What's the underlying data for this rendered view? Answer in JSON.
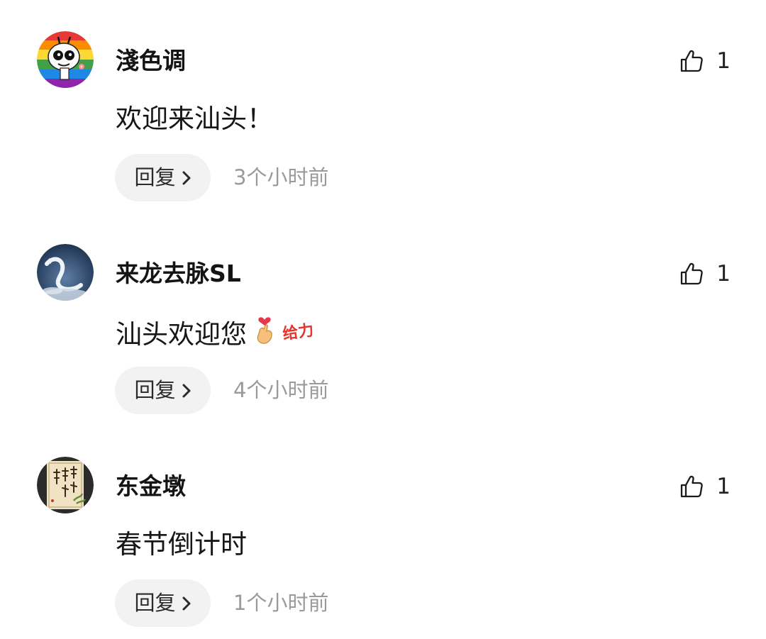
{
  "comments": [
    {
      "username": "淺色调",
      "text": "欢迎来汕头！",
      "likes": "1",
      "reply_label": "回复",
      "time": "3个小时前",
      "avatar": "cartoon-face-avatar"
    },
    {
      "username": "来龙去脉SL",
      "text": "汕头欢迎您",
      "emojis": [
        "finger-heart-emoji",
        "gei-li-sticker"
      ],
      "sticker_text": "给力",
      "likes": "1",
      "reply_label": "回复",
      "time": "4个小时前",
      "avatar": "dragon-cloud-avatar"
    },
    {
      "username": "东金墩",
      "text": "春节倒计时",
      "likes": "1",
      "reply_label": "回复",
      "time": "1个小时前",
      "avatar": "calligraphy-scroll-avatar"
    }
  ],
  "colors": {
    "background": "#ffffff",
    "reply_pill": "#f2f2f2",
    "time_text": "#9a9a9a",
    "sticker_red": "#e8342c"
  }
}
